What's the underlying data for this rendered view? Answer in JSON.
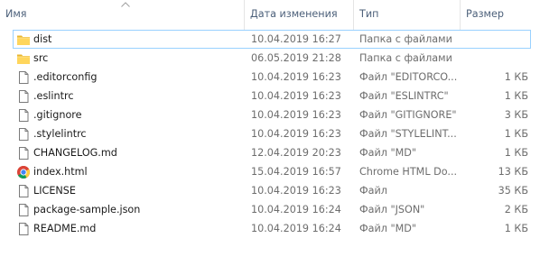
{
  "columns": {
    "name": "Имя",
    "date": "Дата изменения",
    "type": "Тип",
    "size": "Размер"
  },
  "sort": {
    "column": "name",
    "direction": "ascending",
    "icon": "sort-arrow-up-icon"
  },
  "selected_index": 0,
  "files": [
    {
      "name": "dist",
      "date": "10.04.2019 16:27",
      "type": "Папка с файлами",
      "size": "",
      "icon": "folder-icon"
    },
    {
      "name": "src",
      "date": "06.05.2019 21:28",
      "type": "Папка с файлами",
      "size": "",
      "icon": "folder-icon"
    },
    {
      "name": ".editorconfig",
      "date": "10.04.2019 16:23",
      "type": "Файл \"EDITORCO...",
      "size": "1 КБ",
      "icon": "file-icon"
    },
    {
      "name": ".eslintrc",
      "date": "10.04.2019 16:23",
      "type": "Файл \"ESLINTRC\"",
      "size": "1 КБ",
      "icon": "file-icon"
    },
    {
      "name": ".gitignore",
      "date": "10.04.2019 16:23",
      "type": "Файл \"GITIGNORE\"",
      "size": "3 КБ",
      "icon": "file-icon"
    },
    {
      "name": ".stylelintrc",
      "date": "10.04.2019 16:23",
      "type": "Файл \"STYLELINT...",
      "size": "1 КБ",
      "icon": "file-icon"
    },
    {
      "name": "CHANGELOG.md",
      "date": "12.04.2019 20:23",
      "type": "Файл \"MD\"",
      "size": "1 КБ",
      "icon": "file-icon"
    },
    {
      "name": "index.html",
      "date": "15.04.2019 16:57",
      "type": "Chrome HTML Do...",
      "size": "13 КБ",
      "icon": "chrome-icon"
    },
    {
      "name": "LICENSE",
      "date": "10.04.2019 16:23",
      "type": "Файл",
      "size": "35 КБ",
      "icon": "file-icon"
    },
    {
      "name": "package-sample.json",
      "date": "10.04.2019 16:24",
      "type": "Файл \"JSON\"",
      "size": "2 КБ",
      "icon": "file-icon"
    },
    {
      "name": "README.md",
      "date": "10.04.2019 16:24",
      "type": "Файл \"MD\"",
      "size": "1 КБ",
      "icon": "file-icon"
    }
  ],
  "colors": {
    "header_text": "#4c607a",
    "selection_border": "#99d1ff",
    "folder_yellow": "#ffd65c",
    "muted_text": "#6d6d6d"
  }
}
